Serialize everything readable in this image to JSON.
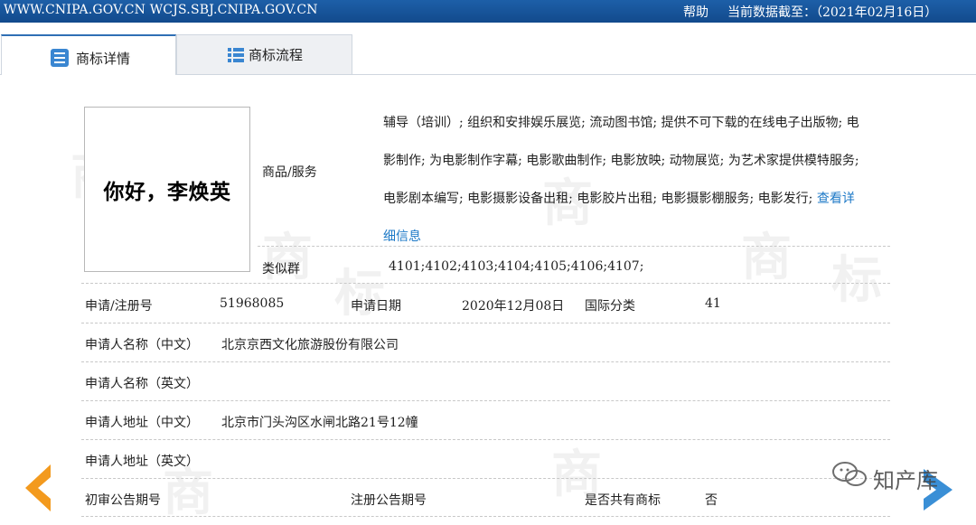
{
  "topbar": {
    "site": "WWW.CNIPA.GOV.CN WCJS.SBJ.CNIPA.GOV.CN",
    "help": "帮助",
    "as_of": "当前数据截至：（2021年02月16日）"
  },
  "tabs": [
    {
      "label": "商标详情",
      "icon": "document-list-icon",
      "active": true
    },
    {
      "label": "商标流程",
      "icon": "list-icon",
      "active": false
    }
  ],
  "mark": {
    "text": "你好，李焕英"
  },
  "goods": {
    "label": "商品/服务",
    "lines": [
      "辅导（培训）; 组织和安排娱乐展览; 流动图书馆; 提供不可下载的在线电子出版物; 电",
      "影制作; 为电影制作字幕; 电影歌曲制作; 电影放映; 动物展览; 为艺术家提供模特服务;",
      "电影剧本编写; 电影摄影设备出租; 电影胶片出租; 电影摄影棚服务; 电影发行; "
    ],
    "more_a": "查看详",
    "more_b": "细信息"
  },
  "similar_group": {
    "label": "类似群",
    "value": "4101;4102;4103;4104;4105;4106;4107;"
  },
  "fields": {
    "reg_no_label": "申请/注册号",
    "reg_no": "51968085",
    "apply_date_label": "申请日期",
    "apply_date": "2020年12月08日",
    "intl_class_label": "国际分类",
    "intl_class": "41",
    "applicant_cn_label": "申请人名称（中文）",
    "applicant_cn": "北京京西文化旅游股份有限公司",
    "applicant_en_label": "申请人名称（英文）",
    "applicant_en": "",
    "address_cn_label": "申请人地址（中文）",
    "address_cn": "北京市门头沟区水闸北路21号12幢",
    "address_en_label": "申请人地址（英文）",
    "address_en": "",
    "prelim_pub_label": "初审公告期号",
    "prelim_pub": "",
    "reg_pub_label": "注册公告期号",
    "reg_pub": "",
    "shared_label": "是否共有商标",
    "shared": "否"
  },
  "watermark": {
    "char1": "商",
    "char2": "标"
  },
  "wechat": {
    "text": "知产库"
  },
  "colors": {
    "topbar": "#1d5fa8",
    "link": "#1d79c7",
    "arrow": "#f39a1e",
    "arrow_right": "#3a8fd6"
  }
}
